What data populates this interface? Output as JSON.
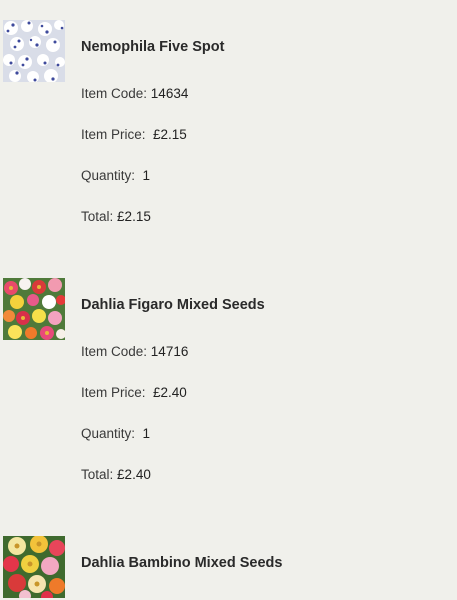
{
  "labels": {
    "item_code": "Item Code:",
    "item_price": "Item Price:",
    "quantity": "Quantity:",
    "total": "Total:"
  },
  "items": [
    {
      "name": "Nemophila Five Spot",
      "image": "nemophila-five-spot-photo",
      "code": "14634",
      "price": "£2.15",
      "quantity": "1",
      "total": "£2.15"
    },
    {
      "name": "Dahlia Figaro Mixed Seeds",
      "image": "dahlia-figaro-mixed-photo",
      "code": "14716",
      "price": "£2.40",
      "quantity": "1",
      "total": "£2.40"
    },
    {
      "name": "Dahlia Bambino Mixed Seeds",
      "image": "dahlia-bambino-mixed-photo"
    }
  ]
}
